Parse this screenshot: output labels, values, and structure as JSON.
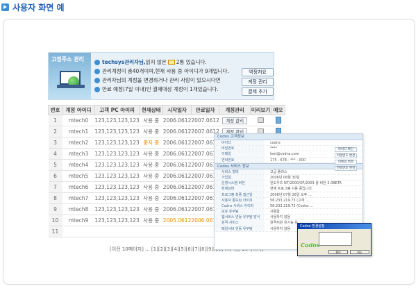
{
  "page": {
    "title": "사용자 화면 예"
  },
  "banner": {
    "label": "고정주소 관리",
    "user": "techsys관리자님,",
    "line1_mid": " 읽지 않은 ",
    "line1_end": "2통 있습니다.",
    "line2": "관리계정이 총40개이며,현재 사용 중 아이디가 9개입니다.",
    "line3": "관리자님의 계정을 변경하거나 관리 사항이 있으시다면",
    "line4": "만료 예정(7일 이내)인 결제대상 계정이 1개있습니다.",
    "btn_history": "역쟁처요",
    "btn_manage": "계정 관리",
    "btn_add": "결제 추가"
  },
  "table": {
    "headers": [
      "번호",
      "계정 아이디",
      "고객 PC 아이피",
      "현재상태",
      "시작일자",
      "만료일자",
      "계정관리",
      "미리보기",
      "메모"
    ],
    "manage_label": "계정 관리",
    "rows": [
      {
        "no": "1",
        "id": "mtech0",
        "ip": "123,123,123,123",
        "status": "사용 중",
        "start": "2006.0612",
        "end": "2007.0612"
      },
      {
        "no": "2",
        "id": "mtech1",
        "ip": "123,123,123,123",
        "status": "사용 중",
        "start": "2006.0612",
        "end": "2007.0612"
      },
      {
        "no": "3",
        "id": "mtech2",
        "ip": "123,123,123,123",
        "status": "중지 중",
        "start": "2006.0612",
        "end": "2007.0612"
      },
      {
        "no": "4",
        "id": "mtech3",
        "ip": "123,123,123,123",
        "status": "사용 중",
        "start": "2006.0612",
        "end": "2007.0612"
      },
      {
        "no": "5",
        "id": "mtech4",
        "ip": "123,123,123,123",
        "status": "사용 중",
        "start": "2006.0612",
        "end": "2007.0612"
      },
      {
        "no": "6",
        "id": "mtech5",
        "ip": "123,123,123,123",
        "status": "사용 중",
        "start": "2006.0612",
        "end": "2007.0612"
      },
      {
        "no": "7",
        "id": "mtech6",
        "ip": "123,123,123,123",
        "status": "사용 중",
        "start": "2006.0612",
        "end": "2007.0612"
      },
      {
        "no": "8",
        "id": "mtech7",
        "ip": "123,123,123,123",
        "status": "사용 중",
        "start": "2006.0612",
        "end": "2007.0612"
      },
      {
        "no": "9",
        "id": "mtech8",
        "ip": "123,123,123,123",
        "status": "사용 중",
        "start": "2006.0612",
        "end": "2007.0612"
      },
      {
        "no": "10",
        "id": "mtech9",
        "ip": "123,123,123,123",
        "status": "사용 중",
        "start": "2005.0612",
        "end": "2006.0612"
      },
      {
        "no": "11",
        "id": "",
        "ip": "",
        "status": "",
        "start": "",
        "end": ""
      }
    ]
  },
  "pager": {
    "text": "[이전 10페이지] ... [1][2][3][4][5][6][7][8][9][10] ...[다음 10페이지]"
  },
  "detail": {
    "title": "Codns 고객정보",
    "section2": "Codns 서비스 정보",
    "info_rows": [
      {
        "k": "아이디",
        "v": "codns"
      },
      {
        "k": "비밀번호",
        "v": "****"
      },
      {
        "k": "이메일",
        "v": "test@codns.com"
      },
      {
        "k": "연락번호",
        "v": "175 - 678 - *** - 000"
      }
    ],
    "btn_check": "아이디 확인",
    "btn_pw": "비밀번호 변경",
    "btn_mail": "이메일 변경",
    "btn_phone": "연락번호 변경",
    "service_rows": [
      {
        "k": "서비스 형태",
        "v": "고급 플러스"
      },
      {
        "k": "가입일",
        "v": "2006년 06월 30일"
      },
      {
        "k": "운영시스템 버전",
        "v": "윈도우즈 NT/2000/XP/2003 용 버전 3.0BETA"
      },
      {
        "k": "현재상태",
        "v": "현재 프로그램 사용 중입니다."
      },
      {
        "k": "프로그램 최종 접근일",
        "v": "2006년 07월 26일 오후 ..."
      },
      {
        "k": "사용자 통보된 아이피",
        "v": "58.233.219.73 (고객 ..."
      },
      {
        "k": "Codns 서비스 아이피",
        "v": "58.233.219.73 (Codns ..."
      },
      {
        "k": "보호 유무탐",
        "v": "사용함"
      },
      {
        "k": "웹서비스 연동 유무탐 방식",
        "v": "사용하지 않음"
      },
      {
        "k": "원격 서비스",
        "v": "원격지원 유기능 유 ..."
      },
      {
        "k": "메일서버 연동 유무탐",
        "v": "사용하지 않음"
      }
    ]
  },
  "popup": {
    "title": "Codns 환경설정",
    "logo": "Codns",
    "btn_ok": "확인",
    "btn_cancel": "취소"
  },
  "colors": {
    "accent": "#3c8fd4",
    "warn": "#e68a00"
  }
}
